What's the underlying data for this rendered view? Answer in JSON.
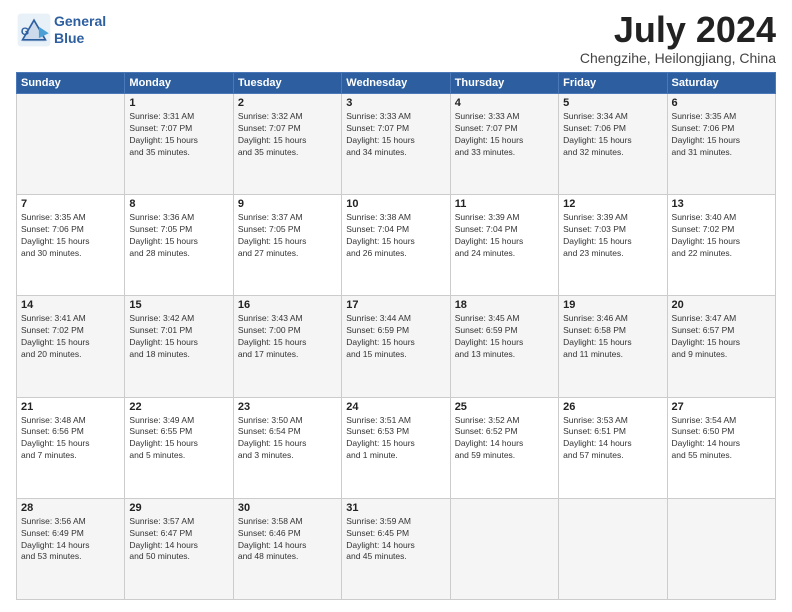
{
  "logo": {
    "line1": "General",
    "line2": "Blue"
  },
  "title": "July 2024",
  "subtitle": "Chengzihe, Heilongjiang, China",
  "weekdays": [
    "Sunday",
    "Monday",
    "Tuesday",
    "Wednesday",
    "Thursday",
    "Friday",
    "Saturday"
  ],
  "weeks": [
    [
      {
        "day": "",
        "info": ""
      },
      {
        "day": "1",
        "info": "Sunrise: 3:31 AM\nSunset: 7:07 PM\nDaylight: 15 hours\nand 35 minutes."
      },
      {
        "day": "2",
        "info": "Sunrise: 3:32 AM\nSunset: 7:07 PM\nDaylight: 15 hours\nand 35 minutes."
      },
      {
        "day": "3",
        "info": "Sunrise: 3:33 AM\nSunset: 7:07 PM\nDaylight: 15 hours\nand 34 minutes."
      },
      {
        "day": "4",
        "info": "Sunrise: 3:33 AM\nSunset: 7:07 PM\nDaylight: 15 hours\nand 33 minutes."
      },
      {
        "day": "5",
        "info": "Sunrise: 3:34 AM\nSunset: 7:06 PM\nDaylight: 15 hours\nand 32 minutes."
      },
      {
        "day": "6",
        "info": "Sunrise: 3:35 AM\nSunset: 7:06 PM\nDaylight: 15 hours\nand 31 minutes."
      }
    ],
    [
      {
        "day": "7",
        "info": "Sunrise: 3:35 AM\nSunset: 7:06 PM\nDaylight: 15 hours\nand 30 minutes."
      },
      {
        "day": "8",
        "info": "Sunrise: 3:36 AM\nSunset: 7:05 PM\nDaylight: 15 hours\nand 28 minutes."
      },
      {
        "day": "9",
        "info": "Sunrise: 3:37 AM\nSunset: 7:05 PM\nDaylight: 15 hours\nand 27 minutes."
      },
      {
        "day": "10",
        "info": "Sunrise: 3:38 AM\nSunset: 7:04 PM\nDaylight: 15 hours\nand 26 minutes."
      },
      {
        "day": "11",
        "info": "Sunrise: 3:39 AM\nSunset: 7:04 PM\nDaylight: 15 hours\nand 24 minutes."
      },
      {
        "day": "12",
        "info": "Sunrise: 3:39 AM\nSunset: 7:03 PM\nDaylight: 15 hours\nand 23 minutes."
      },
      {
        "day": "13",
        "info": "Sunrise: 3:40 AM\nSunset: 7:02 PM\nDaylight: 15 hours\nand 22 minutes."
      }
    ],
    [
      {
        "day": "14",
        "info": "Sunrise: 3:41 AM\nSunset: 7:02 PM\nDaylight: 15 hours\nand 20 minutes."
      },
      {
        "day": "15",
        "info": "Sunrise: 3:42 AM\nSunset: 7:01 PM\nDaylight: 15 hours\nand 18 minutes."
      },
      {
        "day": "16",
        "info": "Sunrise: 3:43 AM\nSunset: 7:00 PM\nDaylight: 15 hours\nand 17 minutes."
      },
      {
        "day": "17",
        "info": "Sunrise: 3:44 AM\nSunset: 6:59 PM\nDaylight: 15 hours\nand 15 minutes."
      },
      {
        "day": "18",
        "info": "Sunrise: 3:45 AM\nSunset: 6:59 PM\nDaylight: 15 hours\nand 13 minutes."
      },
      {
        "day": "19",
        "info": "Sunrise: 3:46 AM\nSunset: 6:58 PM\nDaylight: 15 hours\nand 11 minutes."
      },
      {
        "day": "20",
        "info": "Sunrise: 3:47 AM\nSunset: 6:57 PM\nDaylight: 15 hours\nand 9 minutes."
      }
    ],
    [
      {
        "day": "21",
        "info": "Sunrise: 3:48 AM\nSunset: 6:56 PM\nDaylight: 15 hours\nand 7 minutes."
      },
      {
        "day": "22",
        "info": "Sunrise: 3:49 AM\nSunset: 6:55 PM\nDaylight: 15 hours\nand 5 minutes."
      },
      {
        "day": "23",
        "info": "Sunrise: 3:50 AM\nSunset: 6:54 PM\nDaylight: 15 hours\nand 3 minutes."
      },
      {
        "day": "24",
        "info": "Sunrise: 3:51 AM\nSunset: 6:53 PM\nDaylight: 15 hours\nand 1 minute."
      },
      {
        "day": "25",
        "info": "Sunrise: 3:52 AM\nSunset: 6:52 PM\nDaylight: 14 hours\nand 59 minutes."
      },
      {
        "day": "26",
        "info": "Sunrise: 3:53 AM\nSunset: 6:51 PM\nDaylight: 14 hours\nand 57 minutes."
      },
      {
        "day": "27",
        "info": "Sunrise: 3:54 AM\nSunset: 6:50 PM\nDaylight: 14 hours\nand 55 minutes."
      }
    ],
    [
      {
        "day": "28",
        "info": "Sunrise: 3:56 AM\nSunset: 6:49 PM\nDaylight: 14 hours\nand 53 minutes."
      },
      {
        "day": "29",
        "info": "Sunrise: 3:57 AM\nSunset: 6:47 PM\nDaylight: 14 hours\nand 50 minutes."
      },
      {
        "day": "30",
        "info": "Sunrise: 3:58 AM\nSunset: 6:46 PM\nDaylight: 14 hours\nand 48 minutes."
      },
      {
        "day": "31",
        "info": "Sunrise: 3:59 AM\nSunset: 6:45 PM\nDaylight: 14 hours\nand 45 minutes."
      },
      {
        "day": "",
        "info": ""
      },
      {
        "day": "",
        "info": ""
      },
      {
        "day": "",
        "info": ""
      }
    ]
  ]
}
